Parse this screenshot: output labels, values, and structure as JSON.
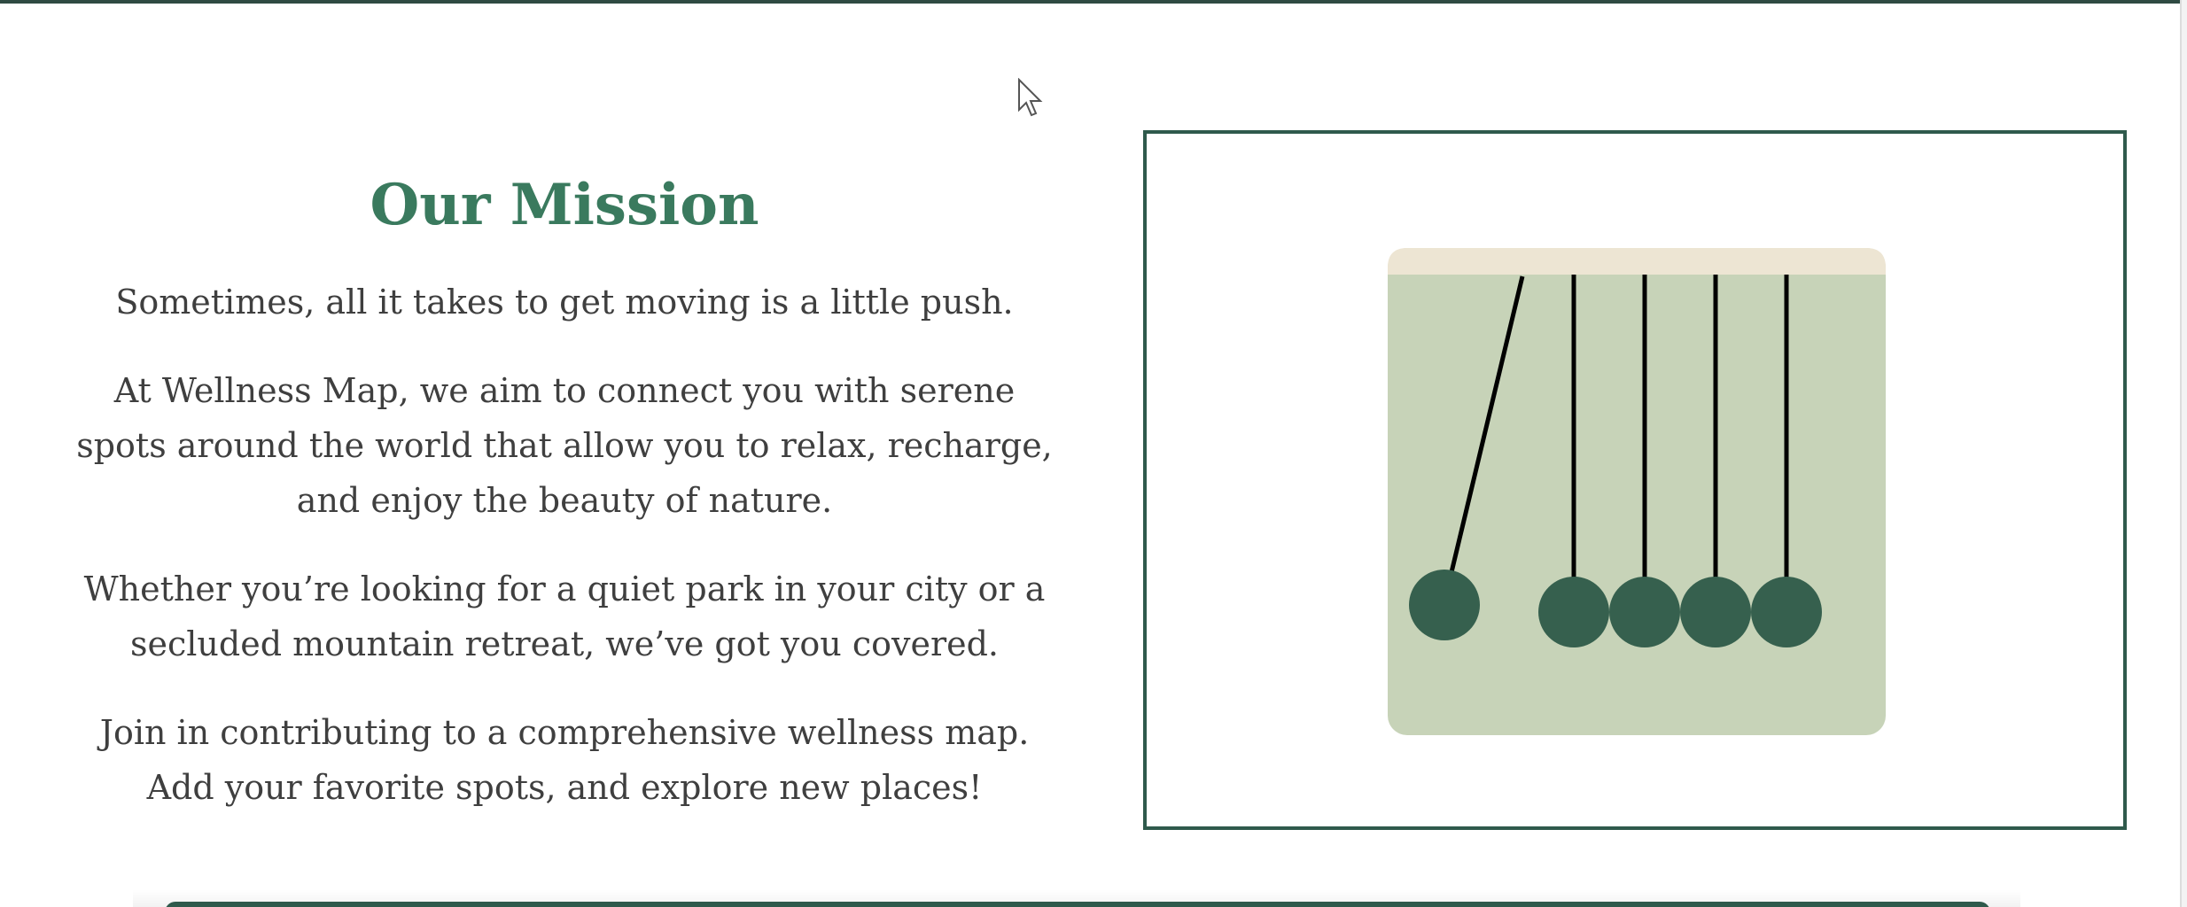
{
  "mission": {
    "title": "Our Mission",
    "paragraphs": [
      "Sometimes, all it takes to get moving is a little push.",
      "At Wellness Map, we aim to connect you with serene spots around the world that allow you to relax, recharge, and enjoy the beauty of nature.",
      "Whether you’re looking for a quiet park in your city or a secluded mountain retreat, we’ve got you covered.",
      "Join in contributing to a comprehensive wellness map. Add your favorite spots, and explore new places!"
    ]
  },
  "illustration": {
    "icon": "newtons-cradle-icon",
    "colors": {
      "frame_border": "#2f5a4c",
      "panel_bg": "#c7d3b8",
      "top_bar": "#ede5d3",
      "ball": "#36604e",
      "string": "#000000"
    }
  },
  "theme": {
    "accent": "#3a7a5e",
    "text": "#3f3f3f"
  }
}
